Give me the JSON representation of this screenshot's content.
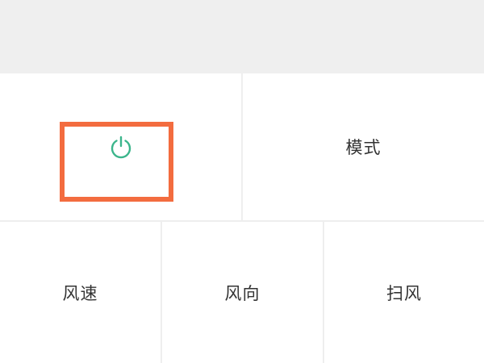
{
  "controls": {
    "power": {
      "icon": "power-icon",
      "color": "#3bb58b"
    },
    "mode_label": "模式",
    "speed_label": "风速",
    "direction_label": "风向",
    "swing_label": "扫风"
  },
  "highlight": {
    "color": "#f36c3f"
  }
}
